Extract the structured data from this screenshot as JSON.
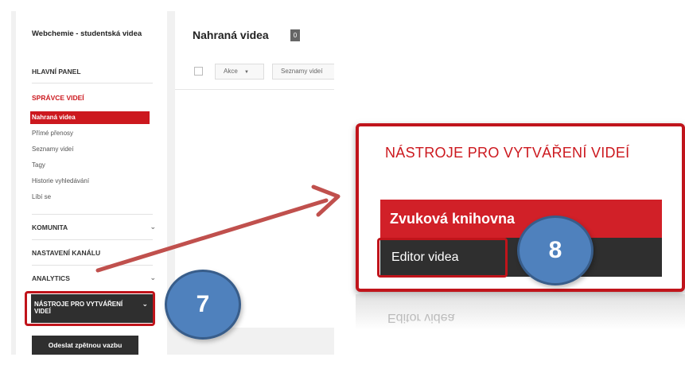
{
  "sidebar": {
    "channel_name": "Webchemie - studentská videa",
    "dashboard": "HLAVNÍ PANEL",
    "video_manager": "SPRÁVCE VIDEÍ",
    "video_manager_items": [
      "Nahraná videa",
      "Přímé přenosy",
      "Seznamy videí",
      "Tagy",
      "Historie vyhledávání",
      "Líbí se"
    ],
    "community": "KOMUNITA",
    "channel_settings": "NASTAVENÍ KANÁLU",
    "analytics": "ANALYTICS",
    "creator_tools": "NÁSTROJE PRO VYTVÁŘENÍ VIDEÍ",
    "feedback_button": "Odeslat zpětnou vazbu"
  },
  "main": {
    "title": "Nahraná videa",
    "count": "0",
    "actions_button": "Akce",
    "playlists_button": "Seznamy videí"
  },
  "callout": {
    "title": "NÁSTROJE PRO VYTVÁŘENÍ VIDEÍ",
    "audio_library": "Zvuková knihovna",
    "video_editor": "Editor videa"
  },
  "steps": [
    "7",
    "8"
  ],
  "colors": {
    "accent_red": "#cc181e",
    "dark_item": "#2f2f2f",
    "step_blue": "#4f81bd",
    "arrow": "#c0504d"
  },
  "icons": [
    "chevron-down-icon",
    "dropdown-caret-icon",
    "arrow-icon"
  ]
}
